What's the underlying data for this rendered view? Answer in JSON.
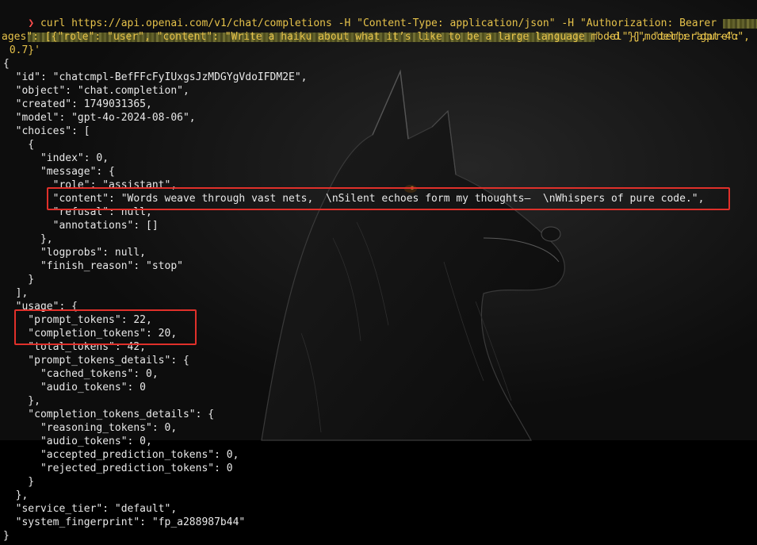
{
  "command": {
    "prompt_symbol": "❯",
    "line1": "curl https://api.openai.com/v1/chat/completions -H \"Content-Type: application/json\" -H \"Authorization: Bearer",
    "line2_tail": "\" -d '{\"model\": \"gpt-4o\", \"mess",
    "line3": "ages\": [{\"role\": \"user\", \"content\": \"Write a haiku about what it’s like to be a large language model\"}], \"temperature\":",
    "line4": " 0.7}'"
  },
  "response_lines": [
    "{",
    "  \"id\": \"chatcmpl-BefFFcFyIUxgsJzMDGYgVdoIFDM2E\",",
    "  \"object\": \"chat.completion\",",
    "  \"created\": 1749031365,",
    "  \"model\": \"gpt-4o-2024-08-06\",",
    "  \"choices\": [",
    "    {",
    "      \"index\": 0,",
    "      \"message\": {",
    "        \"role\": \"assistant\",",
    "        \"content\": \"Words weave through vast nets,  \\nSilent echoes form my thoughts—  \\nWhispers of pure code.\",",
    "        \"refusal\": null,",
    "        \"annotations\": []",
    "      },",
    "      \"logprobs\": null,",
    "      \"finish_reason\": \"stop\"",
    "    }",
    "  ],",
    "  \"usage\": {",
    "    \"prompt_tokens\": 22,",
    "    \"completion_tokens\": 20,",
    "    \"total_tokens\": 42,",
    "    \"prompt_tokens_details\": {",
    "      \"cached_tokens\": 0,",
    "      \"audio_tokens\": 0",
    "    },",
    "    \"completion_tokens_details\": {",
    "      \"reasoning_tokens\": 0,",
    "      \"audio_tokens\": 0,",
    "      \"accepted_prediction_tokens\": 0,",
    "      \"rejected_prediction_tokens\": 0",
    "    }",
    "  },",
    "  \"service_tier\": \"default\",",
    "  \"system_fingerprint\": \"fp_a288987b44\"",
    "}"
  ],
  "colors": {
    "highlight_border": "#e0302a",
    "command_text": "#e6c24a",
    "output_text": "#e8e8e8",
    "prompt_arrow": "#ff4d4d"
  },
  "icons": {
    "wallpaper": "dog-silhouette-icon",
    "redaction": "censor-mosaic"
  }
}
